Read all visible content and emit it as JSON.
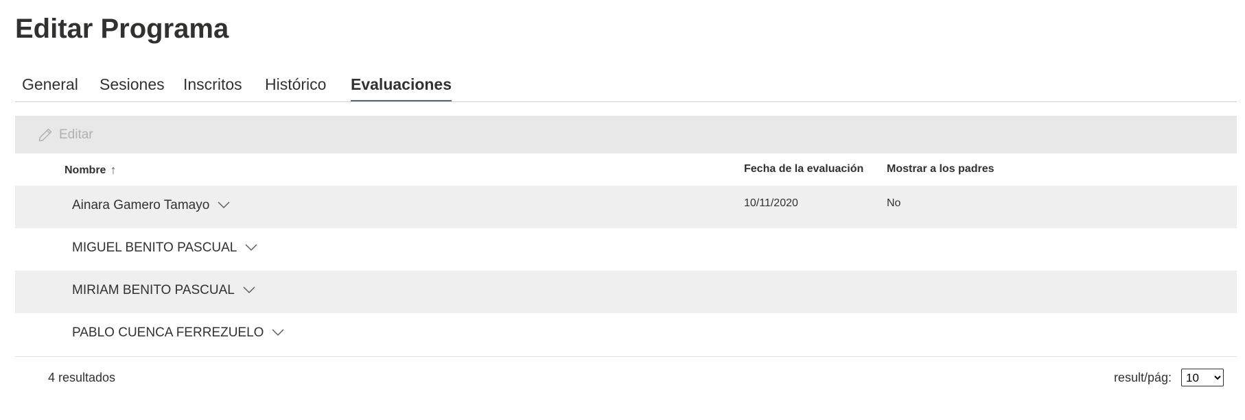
{
  "page": {
    "title": "Editar Programa"
  },
  "tabs": [
    {
      "label": "General",
      "active": false
    },
    {
      "label": "Sesiones",
      "active": false
    },
    {
      "label": "Inscritos",
      "active": false
    },
    {
      "label": "Histórico",
      "active": false
    },
    {
      "label": "Evaluaciones",
      "active": true
    }
  ],
  "toolbar": {
    "edit_label": "Editar",
    "edit_icon": "pencil-icon",
    "edit_enabled": false
  },
  "grid": {
    "columns": {
      "name": "Nombre",
      "name_sort": "↑",
      "date": "Fecha de la evaluación",
      "show_parents": "Mostrar a los padres"
    },
    "rows": [
      {
        "name": "Ainara Gamero Tamayo",
        "date": "10/11/2020",
        "show_parents": "No"
      },
      {
        "name": "MIGUEL BENITO PASCUAL",
        "date": "",
        "show_parents": ""
      },
      {
        "name": "MIRIAM BENITO PASCUAL",
        "date": "",
        "show_parents": ""
      },
      {
        "name": "PABLO CUENCA FERREZUELO",
        "date": "",
        "show_parents": ""
      }
    ]
  },
  "footer": {
    "count_label": "4 resultados",
    "page_size_label": "result/pág:",
    "page_size_value": "10",
    "page_size_options": [
      "10"
    ]
  },
  "colors": {
    "shaded_row": "#efefef",
    "toolbar_bg": "#e8e8e8",
    "disabled_text": "#b3b0ad",
    "tab_underline": "#5a6b7b"
  }
}
